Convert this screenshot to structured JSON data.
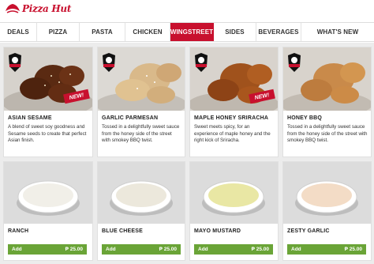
{
  "brand": {
    "name": "Pizza Hut",
    "color": "#c8102e"
  },
  "nav": [
    {
      "label": "DEALS",
      "active": false
    },
    {
      "label": "PIZZA",
      "active": false
    },
    {
      "label": "PASTA",
      "active": false
    },
    {
      "label": "CHICKEN",
      "active": false
    },
    {
      "label": "WINGSTREET",
      "active": true
    },
    {
      "label": "SIDES",
      "active": false
    },
    {
      "label": "BEVERAGES",
      "active": false
    },
    {
      "label": "WHAT'S NEW",
      "active": false
    }
  ],
  "wings": [
    {
      "title": "ASIAN SESAME",
      "description": "A blend of sweet soy goodness and Sesame seeds to create that perfect Asian finish.",
      "badge": "WingStreet",
      "tag": "NEW!"
    },
    {
      "title": "GARLIC PARMESAN",
      "description": "Tossed in a delightfully sweet sauce from the honey side of the street with smokey BBQ twist.",
      "badge": "WingStreet"
    },
    {
      "title": "MAPLE HONEY SRIRACHA",
      "description": "Sweet meets spicy, for an experience of maple honey and the right kick of Sriracha.",
      "badge": "WingStreet",
      "tag": "NEW!"
    },
    {
      "title": "HONEY BBQ",
      "description": "Tossed in a delightfully sweet sauce from the honey side of the street with smokey BBQ twist.",
      "badge": "WingStreet"
    }
  ],
  "dips": [
    {
      "title": "RANCH",
      "add_label": "Add",
      "price": "₱ 25.00",
      "sauce_color": "#f1efe8"
    },
    {
      "title": "BLUE CHEESE",
      "add_label": "Add",
      "price": "₱ 25.00",
      "sauce_color": "#ece8dc"
    },
    {
      "title": "MAYO MUSTARD",
      "add_label": "Add",
      "price": "₱ 25.00",
      "sauce_color": "#e9e7a4"
    },
    {
      "title": "ZESTY GARLIC",
      "add_label": "Add",
      "price": "₱ 25.00",
      "sauce_color": "#f3dcc6"
    }
  ],
  "colors": {
    "accent": "#c8102e",
    "add_button": "#6aa437",
    "background": "#ececec"
  }
}
